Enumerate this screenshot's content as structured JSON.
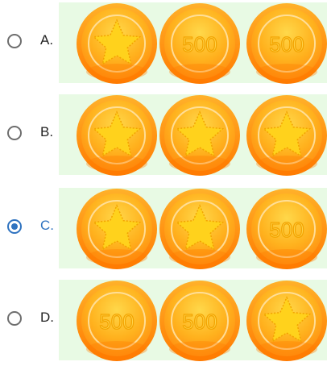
{
  "options": [
    {
      "letter": "A.",
      "selected": false,
      "coins": [
        "star",
        "500",
        "500"
      ]
    },
    {
      "letter": "B.",
      "selected": false,
      "coins": [
        "star",
        "star",
        "star"
      ]
    },
    {
      "letter": "C.",
      "selected": true,
      "coins": [
        "star",
        "star",
        "500"
      ]
    },
    {
      "letter": "D.",
      "selected": false,
      "coins": [
        "500",
        "500",
        "star"
      ]
    }
  ],
  "coin_value_text": "500",
  "colors": {
    "selected_accent": "#2f73c0",
    "panel_bg": "#e8fae4",
    "coin_outer": "#ff9e14",
    "coin_inner": "#ffc21a",
    "star": "#ffd21c"
  },
  "icons": {
    "coin_star": "star-coin-icon",
    "coin_500": "500-coin-icon"
  }
}
